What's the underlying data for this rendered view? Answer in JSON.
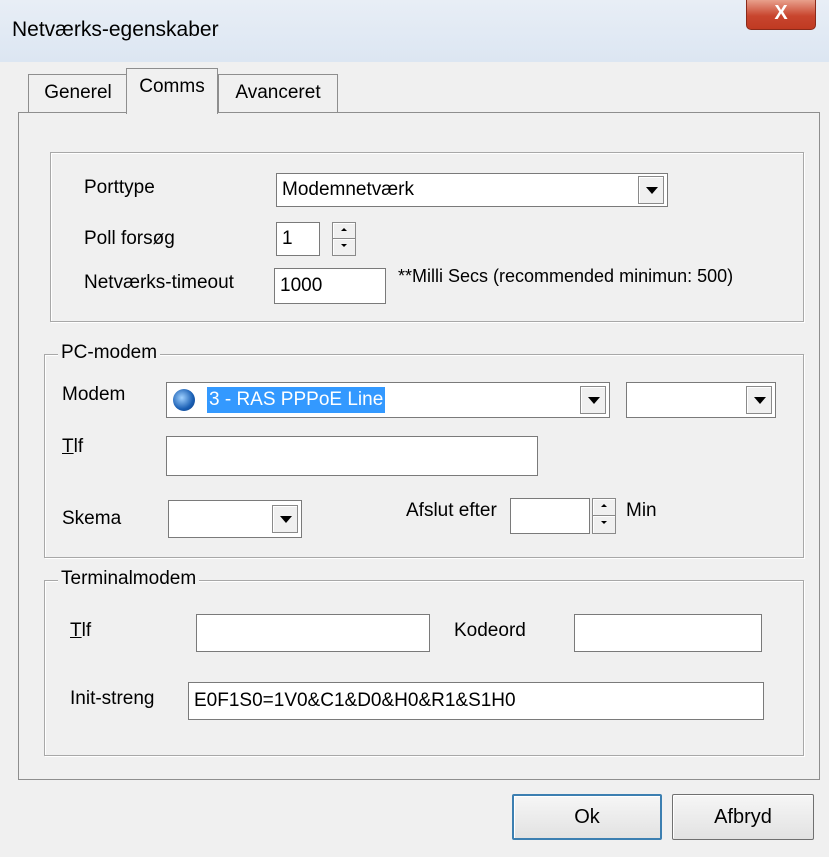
{
  "window": {
    "title": "Netværks-egenskaber",
    "close_glyph": "X"
  },
  "tabs": [
    {
      "label": "Generel",
      "active": false
    },
    {
      "label": "Comms",
      "active": true
    },
    {
      "label": "Avanceret",
      "active": false
    }
  ],
  "comms": {
    "porttype_label": "Porttype",
    "porttype_value": "Modemnetværk",
    "poll_label": "Poll forsøg",
    "poll_value": "1",
    "timeout_label": "Netværks-timeout",
    "timeout_value": "1000",
    "timeout_hint": "**Milli Secs (recommended minimun: 500)"
  },
  "pc_modem": {
    "legend": "PC-modem",
    "modem_label": "Modem",
    "modem_value": "3 - RAS PPPoE Line",
    "modem_icon": "network-modem-icon",
    "modem_secondary_value": "",
    "tlf_label_first": "T",
    "tlf_label_rest": "lf",
    "tlf_value": "",
    "skema_label": "Skema",
    "skema_value": "",
    "afslut_label": "Afslut efter",
    "afslut_value": "",
    "min_label": "Min"
  },
  "terminal_modem": {
    "legend": "Terminalmodem",
    "tlf_label_first": "T",
    "tlf_label_rest": "lf",
    "tlf_value": "",
    "kodeord_label": "Kodeord",
    "kodeord_value": "",
    "init_label": "Init-streng",
    "init_value": "E0F1S0=1V0&C1&D0&H0&R1&S1H0"
  },
  "buttons": {
    "ok": "Ok",
    "cancel": "Afbryd"
  },
  "colors": {
    "selection": "#3399ff",
    "close_button": "#c8452e",
    "default_button_border": "#3c7fb1"
  }
}
